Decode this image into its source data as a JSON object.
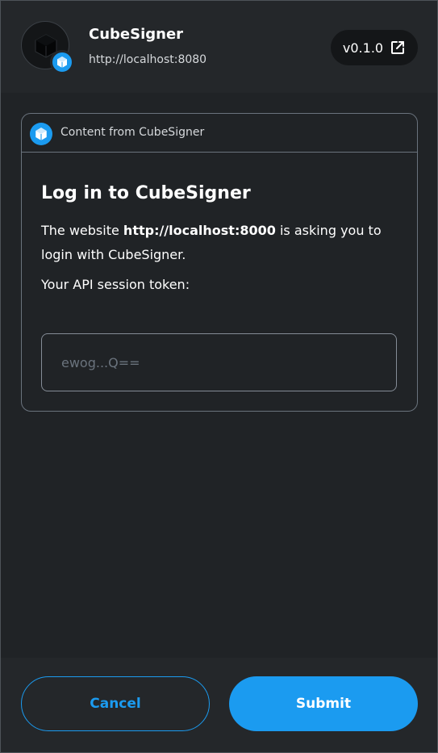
{
  "header": {
    "snap_name": "CubeSigner",
    "snap_origin": "http://localhost:8080",
    "version": "v0.1.0",
    "snap_icon": "cube-icon",
    "badge_icon": "cube-icon",
    "version_icon": "external-link-icon"
  },
  "card": {
    "header_label": "Content from CubeSigner",
    "header_icon": "cube-icon",
    "title": "Log in to CubeSigner",
    "desc_prefix": "The website ",
    "desc_url": "http://localhost:8000",
    "desc_suffix": " is asking you to login with CubeSigner.",
    "token_label": "Your API session token:",
    "token_value": "",
    "token_placeholder": "ewog...Q=="
  },
  "footer": {
    "cancel_label": "Cancel",
    "submit_label": "Submit"
  },
  "colors": {
    "accent": "#1b9bf0",
    "background": "#24272a",
    "content_background": "#202326",
    "border": "#6a737d"
  }
}
